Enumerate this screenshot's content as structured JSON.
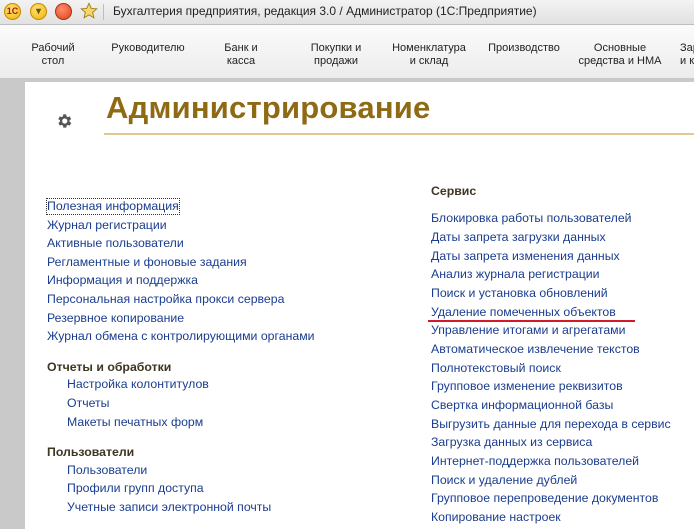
{
  "window": {
    "title": "Бухгалтерия предприятия, редакция 3.0 / Администратор  (1С:Предприятие)",
    "logo_text": "1С"
  },
  "sections": [
    [
      "Рабочий",
      "стол"
    ],
    [
      "Руководителю"
    ],
    [
      "Банк и",
      "касса"
    ],
    [
      "Покупки и",
      "продажи"
    ],
    [
      "Номенклатура",
      "и склад"
    ],
    [
      "Производство"
    ],
    [
      "Основные",
      "средства и НМА"
    ],
    [
      "Зар",
      "и к"
    ]
  ],
  "page": {
    "title": "Администрирование"
  },
  "left_links": [
    "Полезная информация",
    "Журнал регистрации",
    "Активные пользователи",
    "Регламентные и фоновые задания",
    "Информация и поддержка",
    "Персональная настройка прокси сервера",
    "Резервное копирование",
    "Журнал обмена с контролирующими органами"
  ],
  "reports": {
    "heading": "Отчеты и обработки",
    "items": [
      "Настройка колонтитулов",
      "Отчеты",
      "Макеты печатных форм"
    ]
  },
  "users": {
    "heading": "Пользователи",
    "items": [
      "Пользователи",
      "Профили групп доступа",
      "Учетные записи электронной почты"
    ]
  },
  "service": {
    "heading": "Сервис",
    "items": [
      "Блокировка работы пользователей",
      "Даты запрета загрузки данных",
      "Даты запрета изменения данных",
      "Анализ журнала регистрации",
      "Поиск и установка обновлений",
      "Удаление помеченных объектов",
      "Управление итогами и агрегатами",
      "Автоматическое извлечение текстов",
      "Полнотекстовый поиск",
      "Групповое изменение реквизитов",
      "Свертка информационной базы",
      "Выгрузить данные для перехода в сервис",
      "Загрузка данных из сервиса",
      "Интернет-поддержка пользователей",
      "Поиск и удаление дублей",
      "Групповое перепроведение документов",
      "Копирование настроек"
    ]
  },
  "colors": {
    "title": "#8f6a14",
    "link": "#1a3d8f",
    "highlight_underline": "#d11a2a"
  }
}
